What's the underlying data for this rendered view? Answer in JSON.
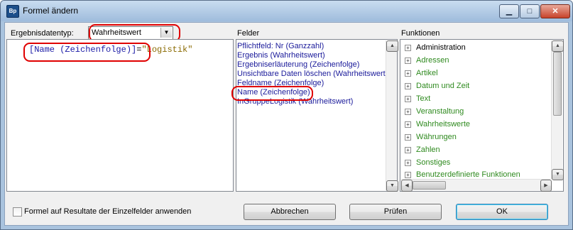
{
  "window": {
    "title": "Formel ändern",
    "icon_text": "Bp",
    "controls": {
      "minimize": "▁",
      "maximize": "□",
      "close": "✕"
    }
  },
  "ergebnis": {
    "label": "Ergebnisdatentyp:",
    "selected": "Wahrheitswert"
  },
  "editor": {
    "field_token": "[Name (Zeichenfolge)]",
    "operator": "=",
    "string_token": "\"Logistik\""
  },
  "felder": {
    "label": "Felder",
    "items": [
      "Pflichtfeld: Nr (Ganzzahl)",
      "Ergebnis (Wahrheitswert)",
      "Ergebniserläuterung (Zeichenfolge)",
      "Unsichtbare Daten löschen (Wahrheitswert)",
      "Feldname (Zeichenfolge)",
      "Name (Zeichenfolge)",
      "InGruppeLogistik (Wahrheitswert)"
    ],
    "highlighted_index": 5
  },
  "funktionen": {
    "label": "Funktionen",
    "items": [
      "Administration",
      "Adressen",
      "Artikel",
      "Datum und Zeit",
      "Text",
      "Veranstaltung",
      "Wahrheitswerte",
      "Währungen",
      "Zahlen",
      "Sonstiges",
      "Benutzerdefinierte Funktionen"
    ]
  },
  "footer": {
    "checkbox_label": "Formel auf Resultate der Einzelfelder anwenden",
    "checkbox_checked": false,
    "cancel_label": "Abbrechen",
    "check_label": "Prüfen",
    "ok_label": "OK"
  },
  "colors": {
    "highlight_ring": "#e00000",
    "field_text": "#1a1a9a",
    "function_text": "#2f8a1f"
  }
}
